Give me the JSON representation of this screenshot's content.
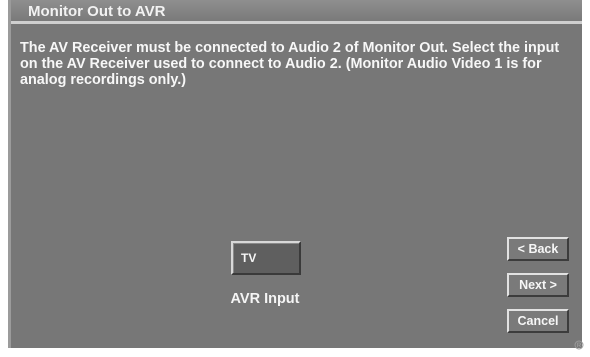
{
  "window": {
    "title": "Monitor Out to AVR"
  },
  "instructions": "The AV Receiver must be connected to Audio 2 of Monitor Out.  Select the input on the AV Receiver used to connect to Audio 2.  (Monitor Audio Video 1 is for analog recordings only.)",
  "avr_input": {
    "value": "TV",
    "label": "AVR Input"
  },
  "buttons": {
    "back": "< Back",
    "next": "Next >",
    "cancel": "Cancel"
  },
  "colors": {
    "background": "#777777",
    "text": "#f7f7f7",
    "highlight_border": "#e2e2e2",
    "shadow_border": "#3c3c3c"
  }
}
